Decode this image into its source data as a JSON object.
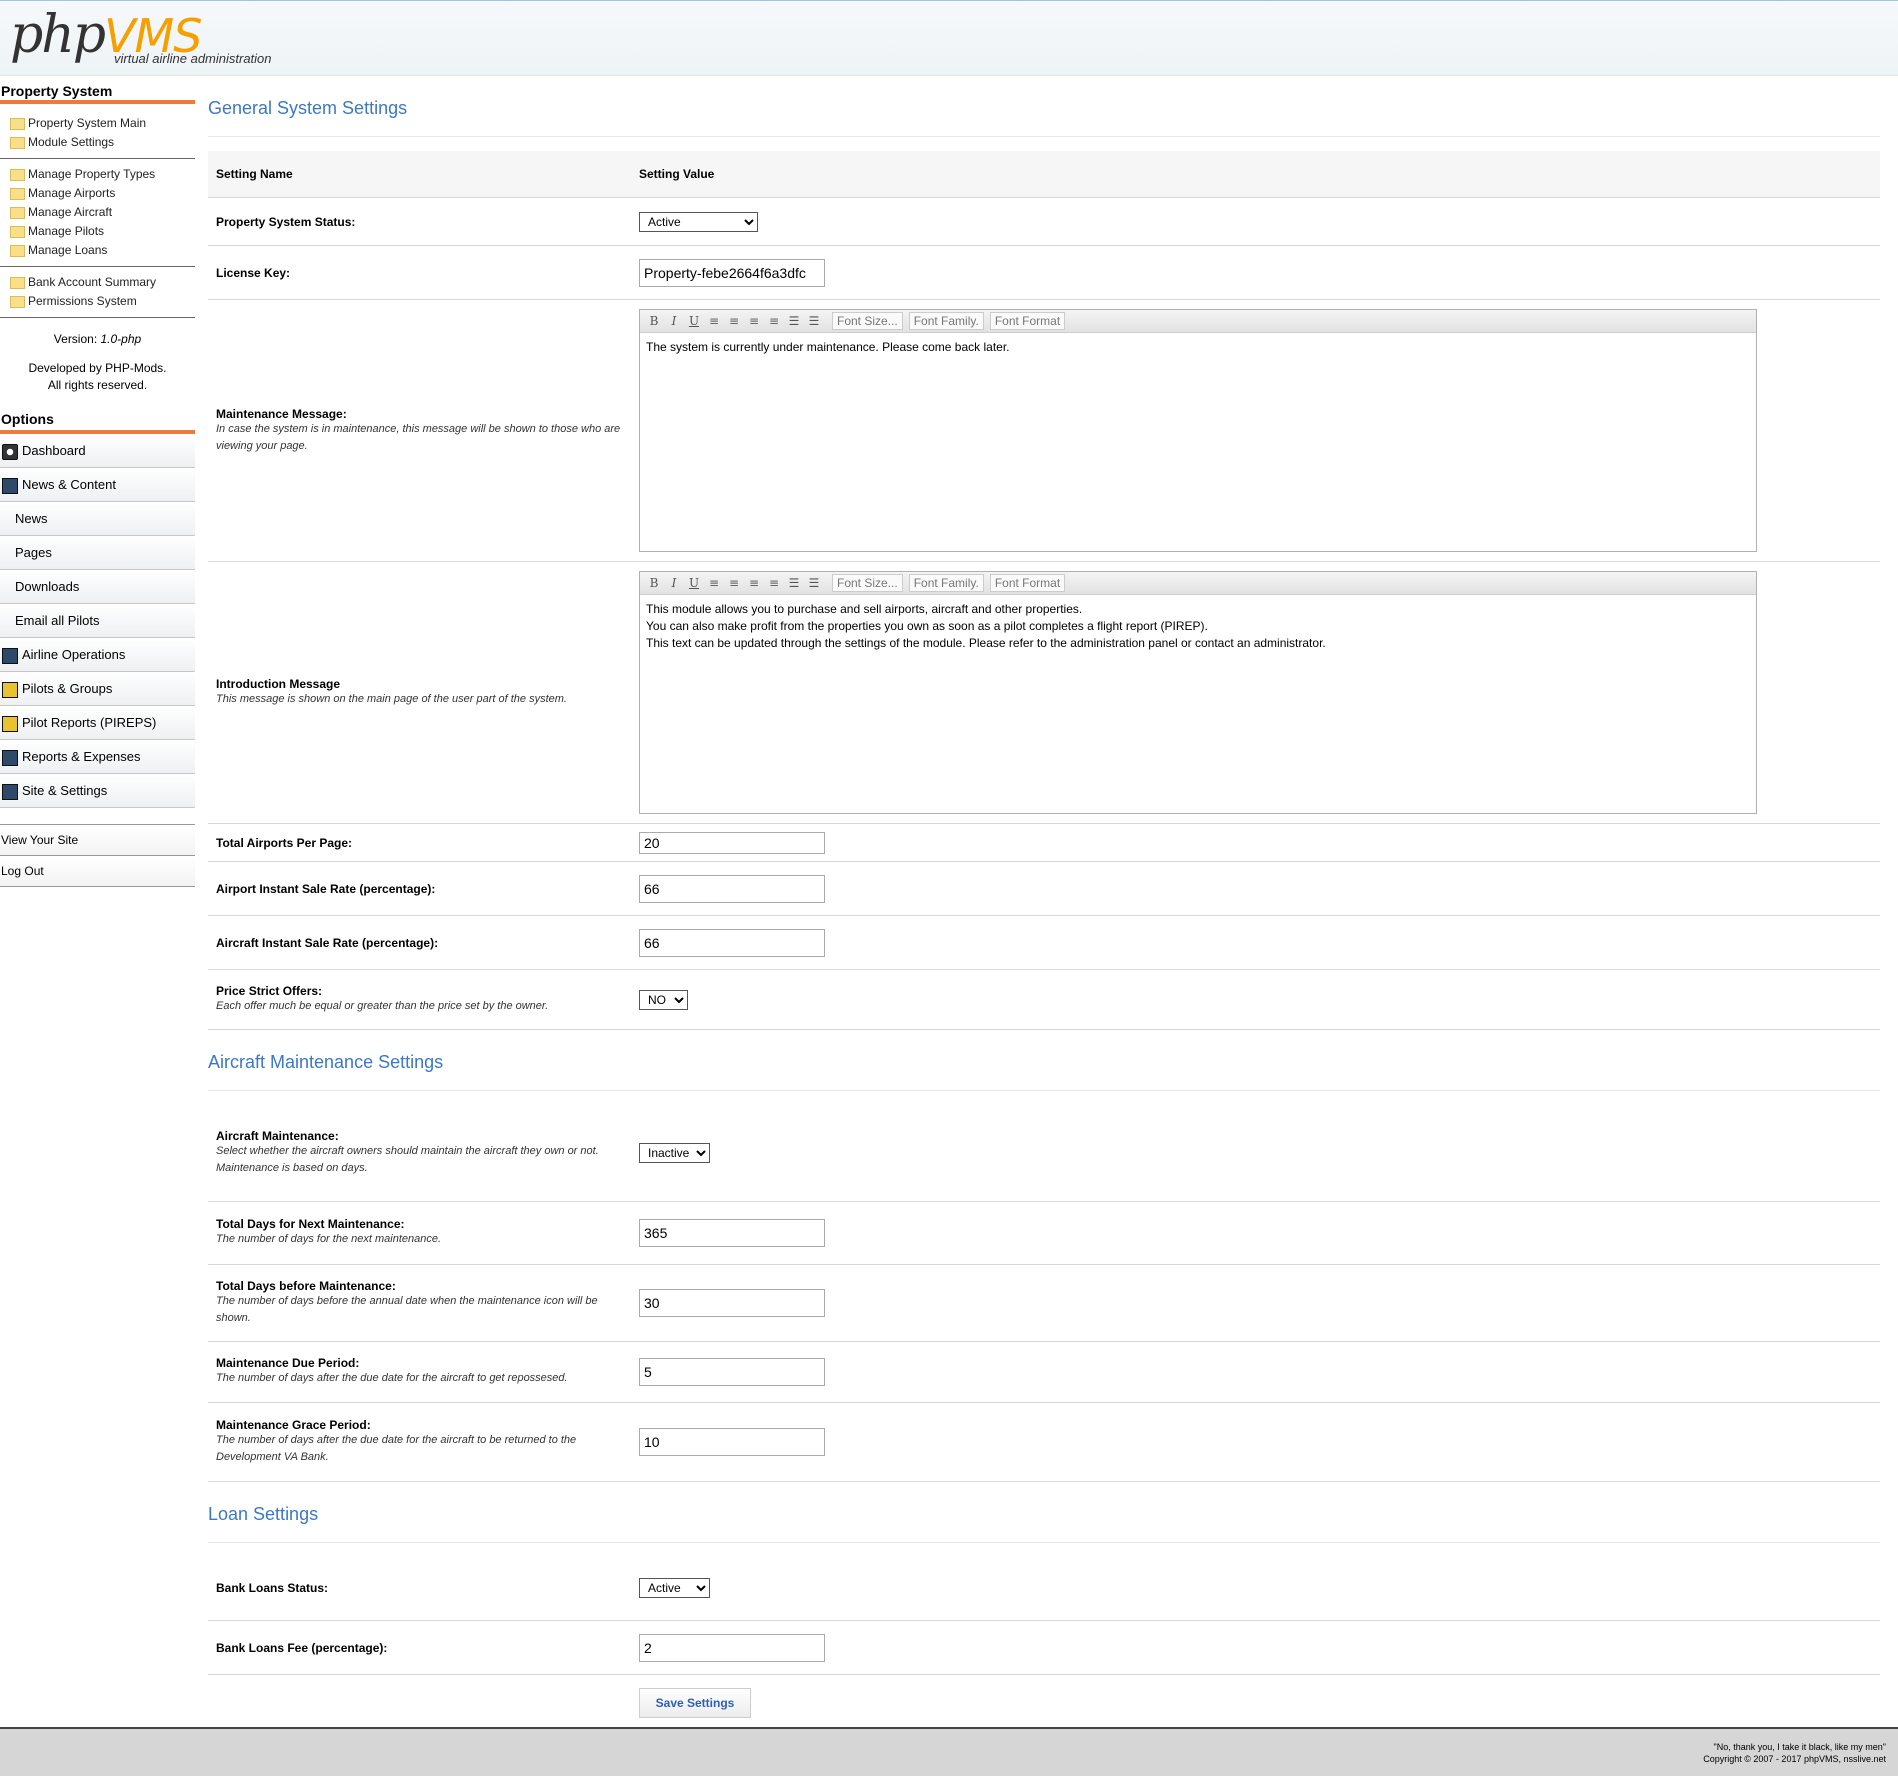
{
  "header": {
    "logo_php": "php",
    "logo_vms": "VMS",
    "tagline": "virtual airline administration"
  },
  "sidebar": {
    "title": "Property System",
    "group1": [
      "Property System Main",
      "Module Settings"
    ],
    "group2": [
      "Manage Property Types",
      "Manage Airports",
      "Manage Aircraft",
      "Manage Pilots",
      "Manage Loans"
    ],
    "group3": [
      "Bank Account Summary",
      "Permissions System"
    ],
    "version_label": "Version:",
    "version": "1.0-php",
    "developed_by": "Developed by PHP-Mods.",
    "rights": "All rights reserved.",
    "options_title": "Options",
    "options": [
      "Dashboard",
      "News & Content",
      "News",
      "Pages",
      "Downloads",
      "Email all Pilots",
      "Airline Operations",
      "Pilots & Groups",
      "Pilot Reports (PIREPS)",
      "Reports & Expenses",
      "Site & Settings"
    ],
    "bottom_links": [
      "View Your Site",
      "Log Out"
    ]
  },
  "general": {
    "title": "General System Settings",
    "col_name": "Setting Name",
    "col_value": "Setting Value",
    "status_label": "Property System Status:",
    "status_value": "Active",
    "license_label": "License Key:",
    "license_value": "Property-febe2664f6a3dfc",
    "maint_msg_label": "Maintenance Message:",
    "maint_msg_desc": "In case the system is in maintenance, this message will be shown to those who are viewing your page.",
    "maint_msg_text": "The system is currently under maintenance. Please come back later.",
    "intro_label": "Introduction Message",
    "intro_desc": "This message is shown on the main page of the user part of the system.",
    "intro_lines": [
      "This module allows you to purchase and sell airports, aircraft and other properties.",
      "You can also make profit from the properties you own as soon as a pilot completes a flight report (PIREP).",
      "This text can be updated through the settings of the module. Please refer to the administration panel or contact an administrator."
    ],
    "editor_toolbar": {
      "font_size": "Font Size...",
      "font_family": "Font Family.",
      "font_format": "Font Format"
    },
    "airports_per_page_label": "Total Airports Per Page:",
    "airports_per_page_value": "20",
    "airport_sale_label": "Airport Instant Sale Rate (percentage):",
    "airport_sale_value": "66",
    "aircraft_sale_label": "Aircraft Instant Sale Rate (percentage):",
    "aircraft_sale_value": "66",
    "price_strict_label": "Price Strict Offers:",
    "price_strict_desc": "Each offer much be equal or greater than the price set by the owner.",
    "price_strict_value": "NO"
  },
  "maintenance": {
    "title": "Aircraft Maintenance Settings",
    "am_label": "Aircraft Maintenance:",
    "am_desc": "Select whether the aircraft owners should maintain the aircraft they own or not. Maintenance is based on days.",
    "am_value": "Inactive",
    "next_label": "Total Days for Next Maintenance:",
    "next_desc": "The number of days for the next maintenance.",
    "next_value": "365",
    "before_label": "Total Days before Maintenance:",
    "before_desc": "The number of days before the annual date when the maintenance icon will be shown.",
    "before_value": "30",
    "due_label": "Maintenance Due Period:",
    "due_desc": "The number of days after the due date for the aircraft to get repossesed.",
    "due_value": "5",
    "grace_label": "Maintenance Grace Period:",
    "grace_desc": "The number of days after the due date for the aircraft to be returned to the Development VA Bank.",
    "grace_value": "10"
  },
  "loans": {
    "title": "Loan Settings",
    "status_label": "Bank Loans Status:",
    "status_value": "Active",
    "fee_label": "Bank Loans Fee (percentage):",
    "fee_value": "2",
    "save_button": "Save Settings"
  },
  "footer": {
    "quote": "\"No, thank you, I take it black, like my men\"",
    "copyright": "Copyright © 2007 - 2017 phpVMS, nsslive.net"
  }
}
